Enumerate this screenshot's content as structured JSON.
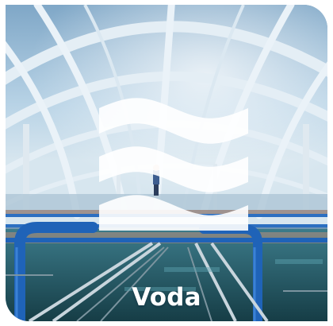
{
  "tile": {
    "label": "Voda",
    "icon": "water-waves-icon",
    "colors": {
      "label": "#ffffff",
      "icon": "#ffffff",
      "pipes": "#1f63b8",
      "water": "#1e5a66"
    }
  }
}
